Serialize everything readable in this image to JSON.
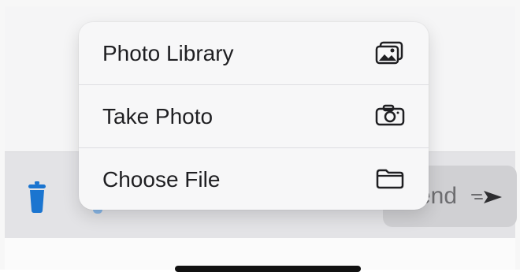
{
  "menu": {
    "items": [
      {
        "label": "Photo Library",
        "icon": "photo-library-icon"
      },
      {
        "label": "Take Photo",
        "icon": "camera-icon"
      },
      {
        "label": "Choose File",
        "icon": "folder-icon"
      }
    ]
  },
  "composer": {
    "send_label_partial": "end",
    "send_icon": "send-arrow-icon",
    "trash_icon": "trash-icon"
  },
  "colors": {
    "trash": "#1b75d0",
    "send_button_bg": "#d0d0d3",
    "menu_bg": "#f7f7f8",
    "toolbar_bg": "#e3e3e6"
  }
}
